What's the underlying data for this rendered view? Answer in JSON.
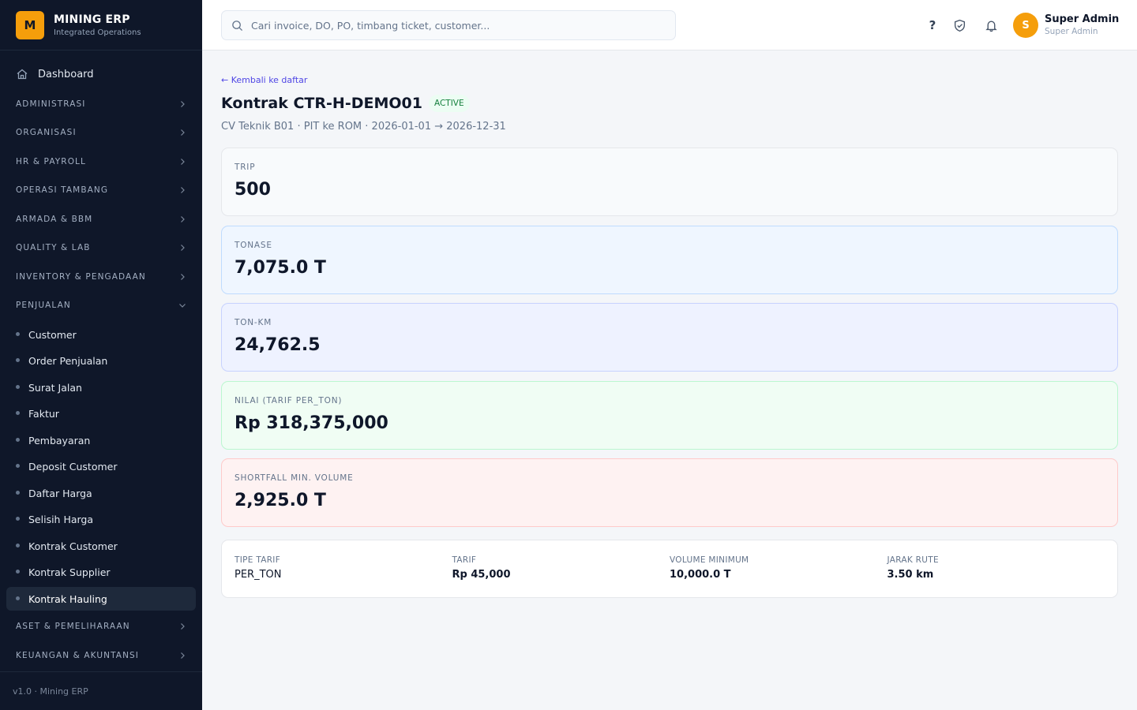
{
  "brand": {
    "logo_letter": "M",
    "title": "MINING ERP",
    "subtitle": "Integrated Operations"
  },
  "sidebar": {
    "dashboard_label": "Dashboard",
    "sections": [
      {
        "label": "ADMINISTRASI",
        "expanded": false
      },
      {
        "label": "ORGANISASI",
        "expanded": false
      },
      {
        "label": "HR & PAYROLL",
        "expanded": false
      },
      {
        "label": "OPERASI TAMBANG",
        "expanded": false
      },
      {
        "label": "ARMADA & BBM",
        "expanded": false
      },
      {
        "label": "QUALITY & LAB",
        "expanded": false
      },
      {
        "label": "INVENTORY & PENGADAAN",
        "expanded": false
      },
      {
        "label": "PENJUALAN",
        "expanded": true
      }
    ],
    "penjualan_items": [
      "Customer",
      "Order Penjualan",
      "Surat Jalan",
      "Faktur",
      "Pembayaran",
      "Deposit Customer",
      "Daftar Harga",
      "Selisih Harga",
      "Kontrak Customer",
      "Kontrak Supplier",
      "Kontrak Hauling"
    ],
    "active_item": "Kontrak Hauling",
    "sections_after": [
      {
        "label": "ASET & PEMELIHARAAN",
        "expanded": false
      },
      {
        "label": "KEUANGAN & AKUNTANSI",
        "expanded": false
      }
    ],
    "footer": "v1.0 · Mining ERP"
  },
  "topbar": {
    "search_placeholder": "Cari invoice, DO, PO, timbang ticket, customer...",
    "help_label": "?",
    "user": {
      "initial": "S",
      "name": "Super Admin",
      "role": "Super Admin"
    }
  },
  "page": {
    "back_link": "← Kembali ke daftar",
    "title": "Kontrak CTR-H-DEMO01",
    "status": "ACTIVE",
    "subtitle": "CV Teknik B01 · PIT ke ROM · 2026-01-01 → 2026-12-31"
  },
  "stats": [
    {
      "label": "TRIP",
      "value": "500"
    },
    {
      "label": "TONASE",
      "value": "7,075.0 T"
    },
    {
      "label": "TON-KM",
      "value": "24,762.5"
    },
    {
      "label": "NILAI (TARIF PER_TON)",
      "value": "Rp 318,375,000"
    },
    {
      "label": "SHORTFALL MIN. VOLUME",
      "value": "2,925.0 T"
    }
  ],
  "details": [
    {
      "label": "TIPE TARIF",
      "value": "PER_TON"
    },
    {
      "label": "TARIF",
      "value": "Rp 45,000"
    },
    {
      "label": "VOLUME MINIMUM",
      "value": "10,000.0 T"
    },
    {
      "label": "JARAK RUTE",
      "value": "3.50 km"
    }
  ],
  "colors": {
    "sidebar_bg": "#0f1729",
    "accent": "#f59e0b",
    "link": "#4f46e5",
    "status_active": "#15803d"
  }
}
